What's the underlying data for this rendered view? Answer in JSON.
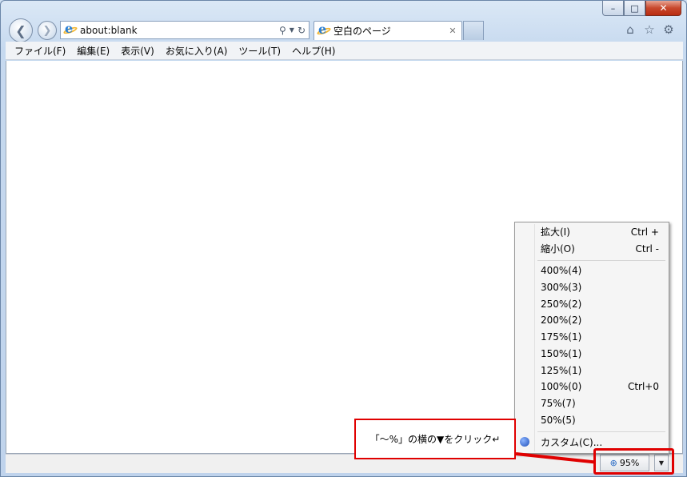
{
  "browser": {
    "address_url": "about:blank",
    "tab_title": "空白のページ",
    "menu": [
      "ファイル(F)",
      "編集(E)",
      "表示(V)",
      "お気に入り(A)",
      "ツール(T)",
      "ヘルプ(H)"
    ],
    "zoom_level": "95%"
  },
  "zoom_menu": {
    "zoom_in": {
      "label": "拡大(I)",
      "shortcut": "Ctrl +"
    },
    "zoom_out": {
      "label": "縮小(O)",
      "shortcut": "Ctrl -"
    },
    "levels": [
      {
        "label": "400%(4)",
        "shortcut": ""
      },
      {
        "label": "300%(3)",
        "shortcut": ""
      },
      {
        "label": "250%(2)",
        "shortcut": ""
      },
      {
        "label": "200%(2)",
        "shortcut": ""
      },
      {
        "label": "175%(1)",
        "shortcut": ""
      },
      {
        "label": "150%(1)",
        "shortcut": ""
      },
      {
        "label": "125%(1)",
        "shortcut": ""
      },
      {
        "label": "100%(0)",
        "shortcut": "Ctrl+0"
      },
      {
        "label": "75%(7)",
        "shortcut": ""
      },
      {
        "label": "50%(5)",
        "shortcut": ""
      }
    ],
    "custom": "カスタム(C)..."
  },
  "annotation": {
    "callout_text": "「～%」の横の▼をクリック↵"
  },
  "colors": {
    "annotation_red": "#e00000",
    "ie_blue": "#2a7fd6",
    "close_red": "#c8482c"
  },
  "icons": [
    "back-arrow-icon",
    "forward-arrow-icon",
    "ie-logo-icon",
    "search-icon",
    "refresh-icon",
    "close-icon",
    "home-icon",
    "star-icon",
    "gear-icon",
    "zoom-icon",
    "dropdown-arrow-icon"
  ]
}
